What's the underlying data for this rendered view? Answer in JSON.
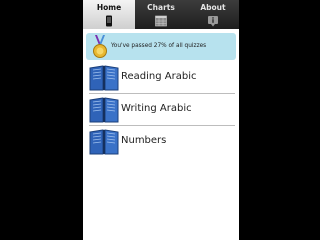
{
  "tabs": [
    {
      "label": "Home",
      "icon": "phone-icon",
      "active": true
    },
    {
      "label": "Charts",
      "icon": "grid-chart-icon",
      "active": false
    },
    {
      "label": "About",
      "icon": "info-icon",
      "active": false
    }
  ],
  "progress": {
    "text": "You've passed 27% of all quizzes",
    "percent": 27,
    "icon": "medal-icon",
    "color": "#b7e2ee"
  },
  "items": [
    {
      "label": "Reading Arabic",
      "icon": "book-icon"
    },
    {
      "label": "Writing Arabic",
      "icon": "book-icon"
    },
    {
      "label": "Numbers",
      "icon": "book-icon"
    }
  ],
  "colors": {
    "book_blue": "#2a5fb3",
    "tabbar_dark": "#2a2a2a",
    "active_tab": "#e0e0e0"
  }
}
